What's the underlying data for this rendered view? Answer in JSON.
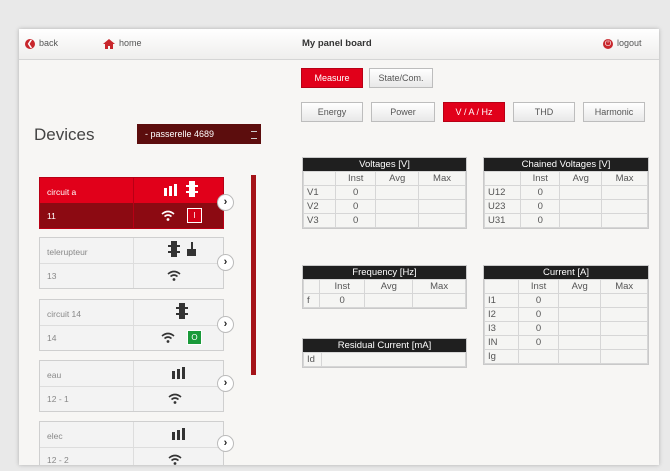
{
  "topbar": {
    "back": "back",
    "home": "home",
    "title": "My panel board",
    "logout": "logout"
  },
  "mode_tabs": [
    "Measure",
    "State/Com."
  ],
  "measure_tabs": [
    "Energy",
    "Power",
    "V / A / Hz",
    "THD",
    "Harmonic"
  ],
  "devices": {
    "title": "Devices",
    "gateway": "- passerelle 4689",
    "items": [
      {
        "name": "circuit a",
        "num": "11",
        "badge": "I"
      },
      {
        "name": "telerupteur",
        "num": "13"
      },
      {
        "name": "circuit 14",
        "num": "14",
        "badge": "O"
      },
      {
        "name": "eau",
        "num": "12 - 1"
      },
      {
        "name": "elec",
        "num": "12 - 2"
      }
    ]
  },
  "colors": {
    "accent": "#e1001a",
    "dark": "#5c0d0d",
    "badge_green": "#1a9a3a"
  },
  "voltages": {
    "title": "Voltages [V]",
    "cols": [
      "Inst",
      "Avg",
      "Max"
    ],
    "rows": [
      [
        "V1",
        "0"
      ],
      [
        "V2",
        "0"
      ],
      [
        "V3",
        "0"
      ]
    ]
  },
  "chained": {
    "title": "Chained Voltages [V]",
    "cols": [
      "Inst",
      "Avg",
      "Max"
    ],
    "rows": [
      [
        "U12",
        "0"
      ],
      [
        "U23",
        "0"
      ],
      [
        "U31",
        "0"
      ]
    ]
  },
  "frequency": {
    "title": "Frequency [Hz]",
    "cols": [
      "Inst",
      "Avg",
      "Max"
    ],
    "row": [
      "f",
      "0"
    ]
  },
  "current": {
    "title": "Current [A]",
    "cols": [
      "Inst",
      "Avg",
      "Max"
    ],
    "rows": [
      [
        "I1",
        "0"
      ],
      [
        "I2",
        "0"
      ],
      [
        "I3",
        "0"
      ],
      [
        "IN",
        "0"
      ],
      [
        "Ig",
        ""
      ]
    ]
  },
  "residual": {
    "title": "Residual Current [mA]",
    "row": [
      "Id",
      ""
    ]
  }
}
